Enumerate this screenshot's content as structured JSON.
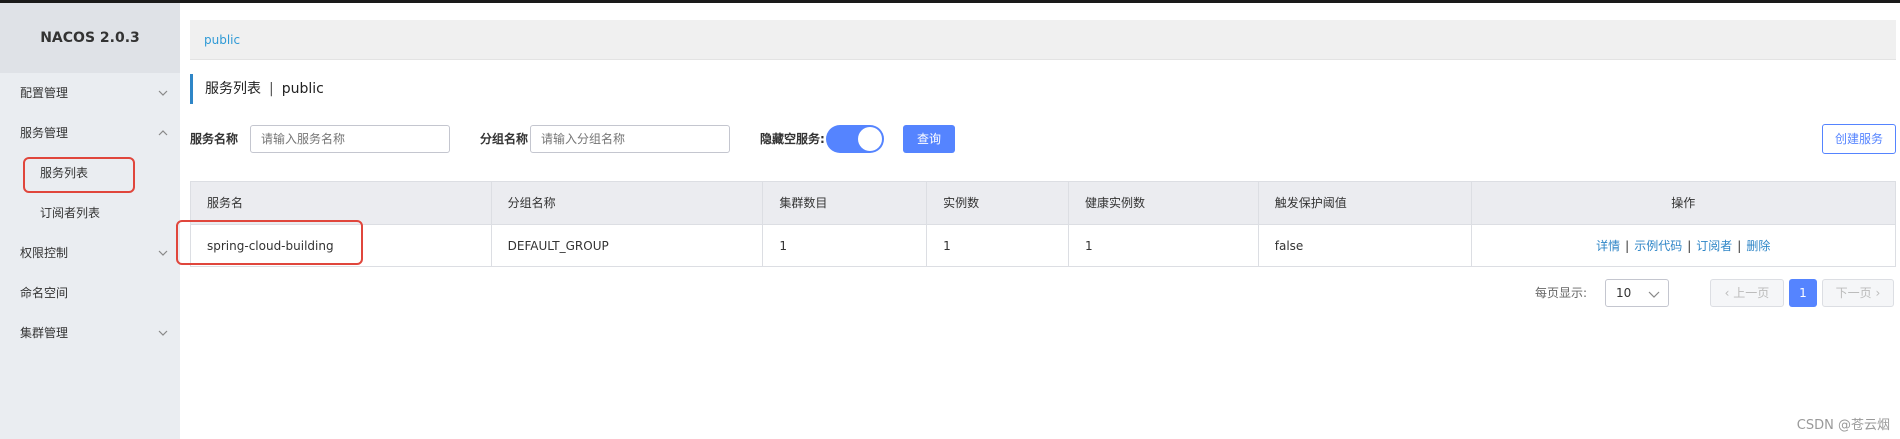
{
  "app": {
    "title": "NACOS 2.0.3"
  },
  "sidebar": {
    "items": [
      {
        "label": "配置管理",
        "expanded": false
      },
      {
        "label": "服务管理",
        "expanded": true,
        "children": [
          {
            "label": "服务列表",
            "active": true
          },
          {
            "label": "订阅者列表",
            "active": false
          }
        ]
      },
      {
        "label": "权限控制",
        "expanded": false
      },
      {
        "label": "命名空间"
      },
      {
        "label": "集群管理",
        "expanded": false
      }
    ]
  },
  "breadcrumb": {
    "namespace": "public"
  },
  "page": {
    "title": "服务列表",
    "separator": "|",
    "namespace": "public"
  },
  "filter": {
    "service_label": "服务名称",
    "service_placeholder": "请输入服务名称",
    "group_label": "分组名称",
    "group_placeholder": "请输入分组名称",
    "hide_empty_label": "隐藏空服务:",
    "hide_empty_on": true,
    "query_button": "查询",
    "create_button": "创建服务"
  },
  "table": {
    "headers": [
      "服务名",
      "分组名称",
      "集群数目",
      "实例数",
      "健康实例数",
      "触发保护阈值",
      "操作"
    ],
    "rows": [
      {
        "service": "spring-cloud-building",
        "group": "DEFAULT_GROUP",
        "clusters": "1",
        "instances": "1",
        "healthy": "1",
        "protect": "false"
      }
    ],
    "ops": {
      "detail": "详情",
      "sample": "示例代码",
      "subscribers": "订阅者",
      "delete": "删除",
      "sep": "|"
    }
  },
  "pagination": {
    "per_page_label": "每页显示:",
    "page_size": "10",
    "prev": "上一页",
    "current": "1",
    "next": "下一页"
  },
  "watermark": "CSDN @苍云烟",
  "colors": {
    "accent": "#5584ff",
    "link": "#2f86c7",
    "highlight": "#e0463c",
    "sidebar_bg": "#eaedf1"
  }
}
